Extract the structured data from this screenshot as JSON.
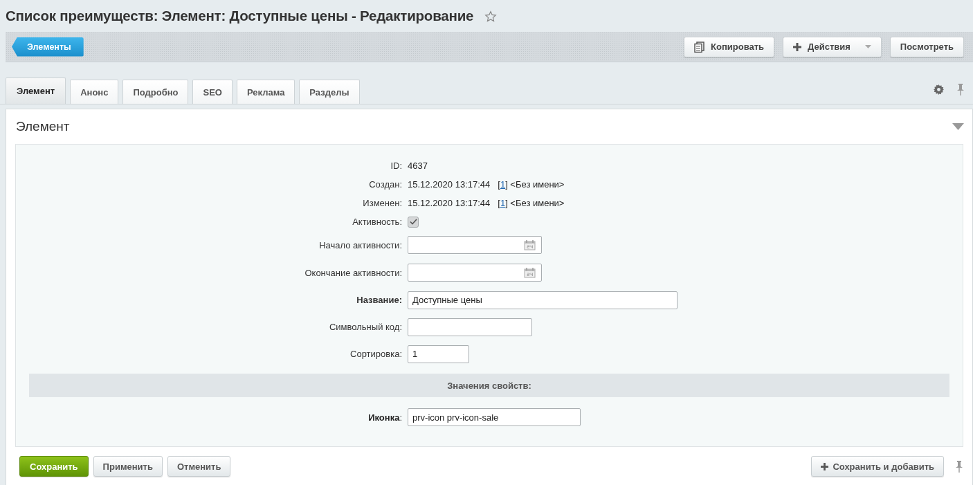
{
  "page_title": "Список преимуществ: Элемент: Доступные цены - Редактирование",
  "favorite": false,
  "toolbar": {
    "back_button": "Элементы",
    "buttons": [
      {
        "label": "Копировать",
        "kind": "copy"
      },
      {
        "label": "Действия",
        "kind": "menu"
      },
      {
        "label": "Посмотреть",
        "kind": "plain"
      }
    ]
  },
  "tabs": [
    {
      "label": "Элемент",
      "selected": true
    },
    {
      "label": "Анонс",
      "selected": false
    },
    {
      "label": "Подробно",
      "selected": false
    },
    {
      "label": "SEO",
      "selected": false
    },
    {
      "label": "Реклама",
      "selected": false
    },
    {
      "label": "Разделы",
      "selected": false
    }
  ],
  "section": {
    "title": "Элемент",
    "expanded": true
  },
  "fields": [
    {
      "kind": "text",
      "label": "ID:",
      "value": "4637"
    },
    {
      "kind": "meta",
      "label": "Создан:",
      "value": "15.12.2020 13:17:44",
      "open": "[",
      "link": "1",
      "after": "] <Без имени>"
    },
    {
      "kind": "meta",
      "label": "Изменен:",
      "value": "15.12.2020 13:17:44",
      "open": "[",
      "link": "1",
      "after": "] <Без имени>"
    },
    {
      "kind": "checkbox",
      "label": "Активность:",
      "checked": true
    },
    {
      "kind": "date",
      "label": "Начало активности:"
    },
    {
      "kind": "date",
      "label": "Окончание активности:"
    },
    {
      "kind": "input",
      "label": "**Название:**",
      "value": "Доступные цены"
    },
    {
      "kind": "input",
      "label": "Символьный код:"
    },
    {
      "kind": "input",
      "label": "Сортировка:",
      "value": "1"
    }
  ],
  "properties": {
    "title": "Значения свойств:",
    "fields": [
      {
        "kind": "input",
        "label": "**Иконка**:",
        "value": "prv-icon prv-icon-sale"
      }
    ]
  },
  "footer": {
    "buttons": [
      {
        "label": "Сохранить",
        "kind": "primary"
      },
      {
        "label": "Применить",
        "kind": "plain"
      },
      {
        "label": "Отменить",
        "kind": "plain"
      }
    ],
    "save_add": "Сохранить и добавить"
  }
}
